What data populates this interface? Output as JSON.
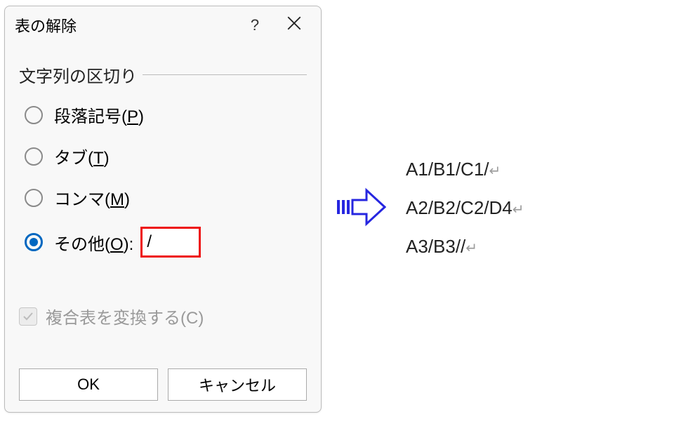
{
  "dialog": {
    "title": "表の解除",
    "help": "?",
    "group_label": "文字列の区切り",
    "radios": {
      "paragraph": {
        "pre": "段落記号(",
        "key": "P",
        "post": ")"
      },
      "tab": {
        "pre": "タブ(",
        "key": "T",
        "post": ")"
      },
      "comma": {
        "pre": "コンマ(",
        "key": "M",
        "post": ")"
      },
      "other": {
        "pre": "その他(",
        "key": "O",
        "post": "):"
      }
    },
    "other_value": "/",
    "checkbox_label": "複合表を変換する(C)",
    "ok": "OK",
    "cancel": "キャンセル"
  },
  "result": {
    "line1": "A1/B1/C1/",
    "line2": "A2/B2/C2/D4",
    "line3": "A3/B3//",
    "para_mark": "↵"
  }
}
